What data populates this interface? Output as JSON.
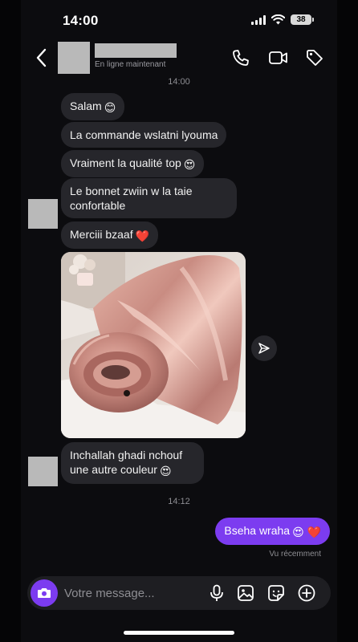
{
  "status": {
    "time": "14:00",
    "battery": "38"
  },
  "header": {
    "presence": "En ligne maintenant"
  },
  "chat": {
    "time_top": "14:00",
    "incoming_1": [
      {
        "text": "Salam",
        "emoji": "😊"
      },
      {
        "text": "La commande wslatni lyouma",
        "emoji": ""
      },
      {
        "text": "Vraiment la qualité top",
        "emoji": "😍"
      },
      {
        "text": "Le bonnet zwiin w la taie confortable",
        "emoji": ""
      },
      {
        "text": "Merciii bzaaf",
        "emoji": "❤️"
      }
    ],
    "incoming_2": {
      "text": "Inchallah ghadi nchouf une autre couleur",
      "emoji": "😍"
    },
    "time_mid": "14:12",
    "outgoing": {
      "text": "Bseha wraha",
      "emoji": "😍 ❤️"
    },
    "seen": "Vu récemment"
  },
  "composer": {
    "placeholder": "Votre message..."
  },
  "icons": {
    "back": "chevron-left-icon",
    "call": "phone-icon",
    "video": "video-camera-icon",
    "tag": "tag-icon",
    "share": "paper-plane-icon",
    "camera": "camera-icon",
    "mic": "microphone-icon",
    "gallery": "image-icon",
    "sticker": "sticker-icon",
    "add": "plus-circle-icon"
  },
  "colors": {
    "accent": "#7c3cf0",
    "bubble_in": "#26262b",
    "background": "#0c0c0f"
  }
}
